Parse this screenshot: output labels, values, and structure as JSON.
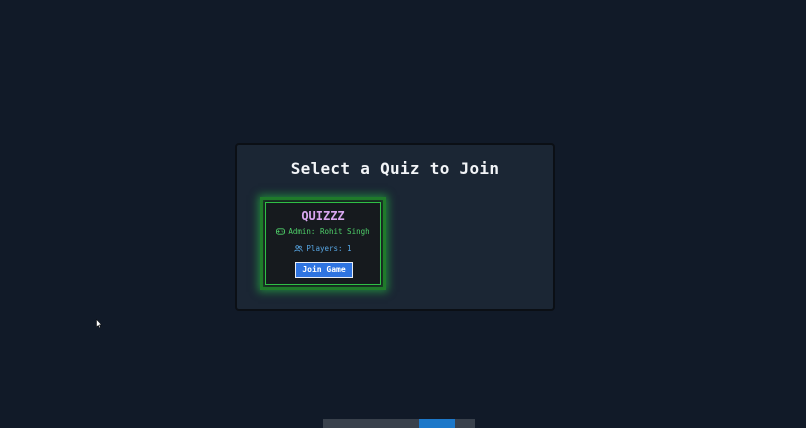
{
  "page": {
    "title": "Select a Quiz to Join"
  },
  "quizzes": [
    {
      "name": "QUIZZZ",
      "admin_label": "Admin: Rohit Singh",
      "players_label": "Players: 1",
      "join_label": "Join Game",
      "icons": {
        "admin": "gamepad-icon",
        "players": "users-icon"
      }
    }
  ],
  "share_bar": {
    "text": "",
    "button_label": "",
    "hide_label": ""
  },
  "colors": {
    "background": "#111a28",
    "panel": "#1b2634",
    "card_glow": "#2fbf45",
    "quiz_name": "#d9a7f0",
    "admin_text": "#4fd06a",
    "players_text": "#58a8e6",
    "join_button": "#2f74e0"
  }
}
